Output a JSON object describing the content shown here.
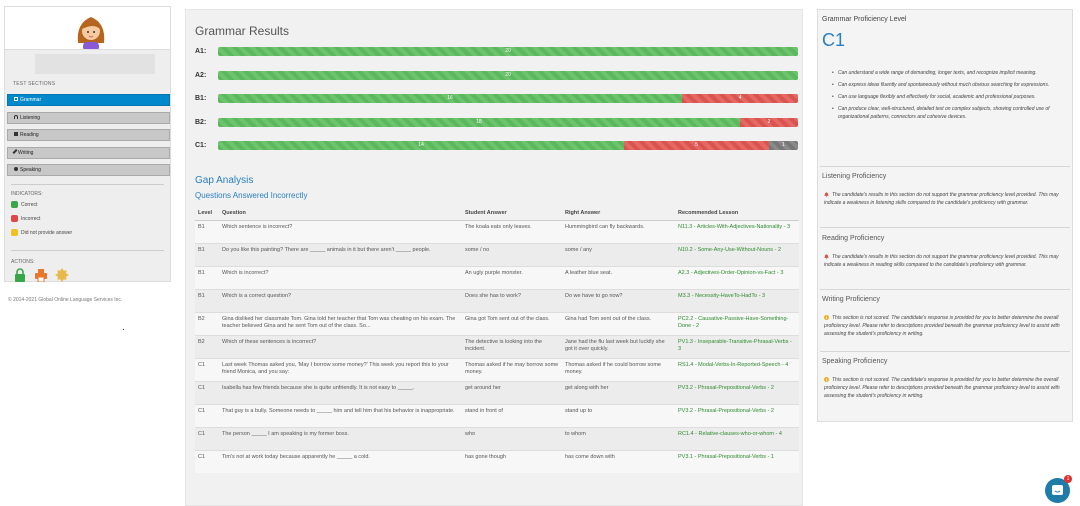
{
  "sidebar": {
    "test_sections_title": "TEST SECTIONS",
    "sections": [
      {
        "label": "Grammar",
        "icon": "list-icon",
        "active": true
      },
      {
        "label": "Listening",
        "icon": "headphones-icon",
        "active": false
      },
      {
        "label": "Reading",
        "icon": "book-icon",
        "active": false
      },
      {
        "label": "Writing",
        "icon": "pencil-icon",
        "active": false
      },
      {
        "label": "Speaking",
        "icon": "microphone-icon",
        "active": false
      }
    ],
    "indicators_title": "INDICATORS:",
    "indicators": [
      {
        "label": "Correct",
        "color": "#3aa64a"
      },
      {
        "label": "Incorrect",
        "color": "#e04848"
      },
      {
        "label": "Did not provide answer",
        "color": "#f0c020"
      }
    ],
    "actions_title": "ACTIONS:",
    "actions": [
      "lock-icon",
      "print-icon",
      "badge-icon"
    ],
    "copyright": "© 2014-2021 Global Online Language Services Inc."
  },
  "grammar_results": {
    "title": "Grammar Results",
    "rows": [
      {
        "level": "A1:",
        "correct": 20,
        "incorrect": 0,
        "no_answer": 0
      },
      {
        "level": "A2:",
        "correct": 20,
        "incorrect": 0,
        "no_answer": 0
      },
      {
        "level": "B1:",
        "correct": 16,
        "incorrect": 4,
        "no_answer": 0
      },
      {
        "level": "B2:",
        "correct": 18,
        "incorrect": 2,
        "no_answer": 0
      },
      {
        "level": "C1:",
        "correct": 14,
        "incorrect": 5,
        "no_answer": 1
      }
    ]
  },
  "gap_analysis": {
    "title": "Gap Analysis",
    "subtitle": "Questions Answered Incorrectly",
    "columns": [
      "Level",
      "Question",
      "Student Answer",
      "Right Answer",
      "Recommended Lesson"
    ],
    "rows": [
      [
        "B1",
        "Which sentence is incorrect?",
        "The koala eats only leaves.",
        "Hummingbird can fly backwards.",
        "N11.3 - Articles-With-Adjectives-Nationality - 3"
      ],
      [
        "B1",
        "Do you like this painting? There are _____ animals in it but there aren't _____ people.",
        "some / no",
        "some / any",
        "N10.2 - Some-Any-Use-Without-Nouns - 2"
      ],
      [
        "B1",
        "Which is incorrect?",
        "An ugly purple monster.",
        "A leather blue seat.",
        "A2.3 - Adjectives-Order-Opinion-vs-Fact - 3"
      ],
      [
        "B1",
        "Which is a correct question?",
        "Does she has to work?",
        "Do we have to go now?",
        "M3.3 - Necessity-HaveTo-HadTo - 3"
      ],
      [
        "B2",
        "Gina disliked her classmate Tom. Gina told her teacher that Tom was cheating on his exam. The teacher believed Gina and he sent Tom out of the class. So...",
        "Gina got Tom sent out of the class.",
        "Gina had Tom sent out of the class.",
        "PC2.2 - Causative-Passive-Have-Something-Done - 2"
      ],
      [
        "B2",
        "Which of these sentences is incorrect?",
        "The detective is looking into the incident.",
        "Jane had the flu last week but luckily she got it over quickly.",
        "PV1.3 - Inseparable-Transitive-Phrasal-Verbs - 3"
      ],
      [
        "C1",
        "Last week Thomas asked you, 'May I borrow some money?' This week you report this to your friend Monica, and you say:",
        "Thomas asked if he may borrow some money.",
        "Thomas asked if he could borrow some money.",
        "RS1.4 - Modal-Verbs-In-Reported-Speech - 4"
      ],
      [
        "C1",
        "Isabella has few friends because she is quite unfriendly. It is not easy to _____.",
        "get around her",
        "get along with her",
        "PV3.2 - Phrasal-Prepositional-Verbs - 2"
      ],
      [
        "C1",
        "That guy is a bully. Someone needs to _____ him and tell him that his behavior is inappropriate.",
        "stand in front of",
        "stand up to",
        "PV3.2 - Phrasal-Prepositional-Verbs - 2"
      ],
      [
        "C1",
        "The person _____ I am speaking is my former boss.",
        "who",
        "to whom",
        "RC1.4 - Relative-clauses-who-or-whom - 4"
      ],
      [
        "C1",
        "Tim's not at work today because apparently he _____ a cold.",
        "has gone though",
        "has come down with",
        "PV3.1 - Phrasal-Prepositional-Verbs - 1"
      ]
    ]
  },
  "proficiency": {
    "title": "Grammar Proficiency Level",
    "level": "C1",
    "descriptors": [
      "Can understand a wide range of demanding, longer texts, and recognize implicit meaning.",
      "Can express ideas fluently and spontaneously without much obvious searching for expressions.",
      "Can use language flexibly and effectively for social, academic and professional purposes.",
      "Can produce clear, well-structured, detailed text on complex subjects, showing controlled use of organizational patterns, connectors and cohesive devices."
    ],
    "sections": [
      {
        "title": "Listening Proficiency",
        "icon": "bell-icon",
        "icon_color": "#d9534f",
        "text": "The candidate's results in this section do not support the grammar proficiency level provided. This may indicate a weakness in listening skills compared to the candidate's proficiency with grammar."
      },
      {
        "title": "Reading Proficiency",
        "icon": "bell-icon",
        "icon_color": "#d9534f",
        "text": "The candidate's results in this section do not support the grammar proficiency level provided. This may indicate a weakness in reading skills compared to the candidate's proficiency with grammar."
      },
      {
        "title": "Writing Proficiency",
        "icon": "info-circle-icon",
        "icon_color": "#f0ad1e",
        "text": "This section is not scored. The candidate's response is provided for you to better determine the overall proficiency level. Please refer to descriptions provided beneath the grammar proficiency level to assist with assessing the student's proficiency in writing."
      },
      {
        "title": "Speaking Proficiency",
        "icon": "info-circle-icon",
        "icon_color": "#f0ad1e",
        "text": "This section is not scored. The candidate's response is provided for you to better determine the overall proficiency level. Please refer to descriptions provided beneath the grammar proficiency level to assist with assessing the student's proficiency in writing."
      }
    ]
  },
  "chat": {
    "badge": "1"
  }
}
